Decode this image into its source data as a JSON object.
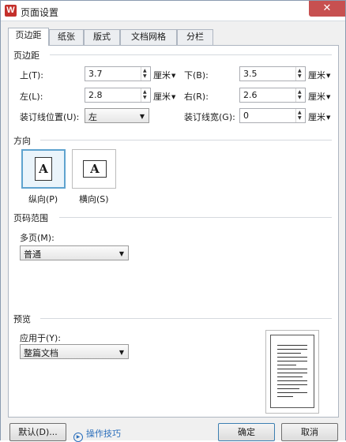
{
  "window": {
    "title": "页面设置",
    "app_icon": "W",
    "close_glyph": "✕"
  },
  "tabs": [
    {
      "label": "页边距",
      "active": true
    },
    {
      "label": "纸张",
      "active": false
    },
    {
      "label": "版式",
      "active": false
    },
    {
      "label": "文档网格",
      "active": false
    },
    {
      "label": "分栏",
      "active": false
    }
  ],
  "margins": {
    "section_title": "页边距",
    "top": {
      "label": "上(T):",
      "value": "3.7",
      "unit": "厘米"
    },
    "bottom": {
      "label": "下(B):",
      "value": "3.5",
      "unit": "厘米"
    },
    "left": {
      "label": "左(L):",
      "value": "2.8",
      "unit": "厘米"
    },
    "right": {
      "label": "右(R):",
      "value": "2.6",
      "unit": "厘米"
    },
    "gutter_position": {
      "label": "装订线位置(U):",
      "value": "左"
    },
    "gutter_width": {
      "label": "装订线宽(G):",
      "value": "0",
      "unit": "厘米"
    }
  },
  "orientation": {
    "section_title": "方向",
    "portrait": {
      "label": "纵向(P)",
      "glyph": "A",
      "selected": true
    },
    "landscape": {
      "label": "横向(S)",
      "glyph": "A",
      "selected": false
    }
  },
  "pages": {
    "section_title": "页码范围",
    "multiple_label": "多页(M):",
    "multiple_value": "普通"
  },
  "preview": {
    "section_title": "预览",
    "apply_label": "应用于(Y):",
    "apply_value": "整篇文档"
  },
  "footer": {
    "default_label": "默认(D)...",
    "tips_label": "操作技巧",
    "ok_label": "确定",
    "cancel_label": "取消"
  },
  "colors": {
    "accent": "#5fa3cf",
    "close": "#c75050",
    "link": "#2a6ebb"
  }
}
